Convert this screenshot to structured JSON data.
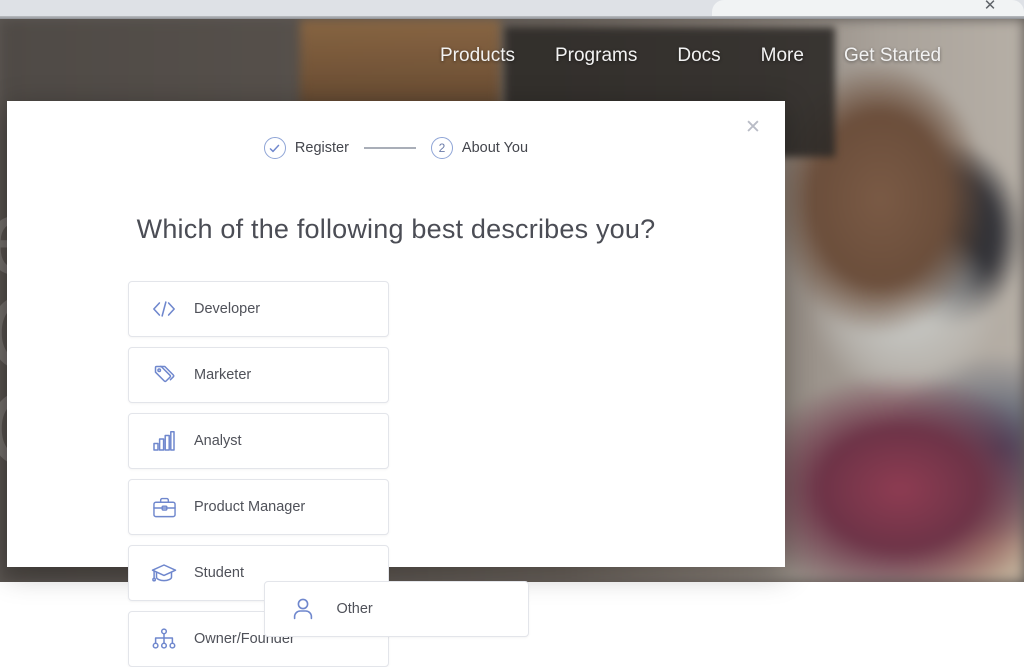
{
  "browser": {
    "tab_close_icon": "close-icon",
    "tab_close_glyph": "✕"
  },
  "site_nav": {
    "items": [
      {
        "label": "Products"
      },
      {
        "label": "Programs"
      },
      {
        "label": "Docs"
      },
      {
        "label": "More"
      },
      {
        "label": "Get Started"
      }
    ]
  },
  "hero": {
    "ghost_text": "e\nC\nC"
  },
  "modal": {
    "close_glyph": "✕",
    "close_icon": "close-icon",
    "stepper": {
      "steps": [
        {
          "label": "Register",
          "state": "complete",
          "icon": "check-circle-icon",
          "number": ""
        },
        {
          "label": "About You",
          "state": "current",
          "icon": "step-number-circle",
          "number": "2"
        }
      ]
    },
    "heading": "Which of the following best describes you?",
    "options": [
      {
        "label": "Developer",
        "icon": "code-brackets-icon"
      },
      {
        "label": "Marketer",
        "icon": "tags-icon"
      },
      {
        "label": "Analyst",
        "icon": "bar-chart-icon"
      },
      {
        "label": "Product Manager",
        "icon": "briefcase-icon"
      },
      {
        "label": "Student",
        "icon": "graduation-cap-icon"
      },
      {
        "label": "Owner/Founder",
        "icon": "org-chart-icon"
      }
    ],
    "other_option": {
      "label": "Other",
      "icon": "person-icon"
    }
  },
  "colors": {
    "accent_blue": "#6f87cd",
    "step_border": "#8ea4d6",
    "text_primary": "#4b4d55",
    "text_secondary": "#4f5159",
    "option_border": "#e3e5ea",
    "modal_bg": "#ffffff",
    "page_bg": "#5d5854"
  }
}
